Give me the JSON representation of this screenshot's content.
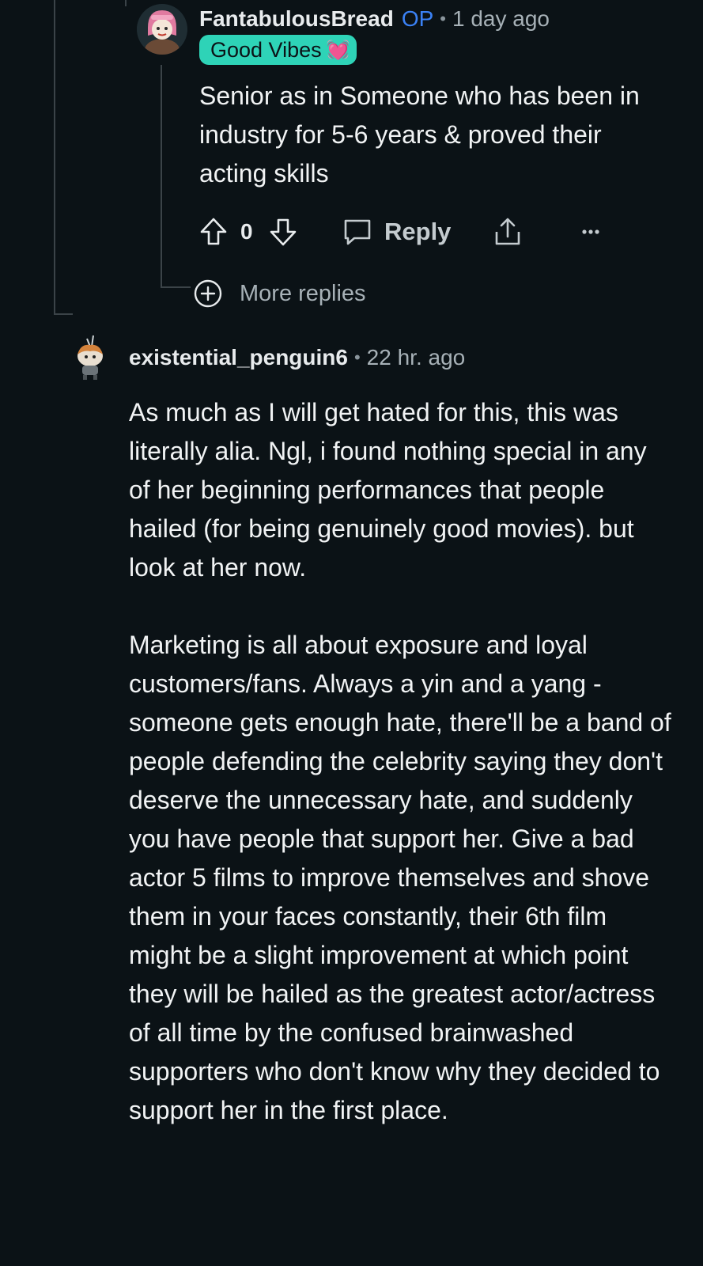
{
  "comment_reply": {
    "author": "FantabulousBread",
    "op_tag": "OP",
    "separator": "•",
    "time": "1 day ago",
    "flair": {
      "text": "Good Vibes",
      "emoji": "💓",
      "color": "#2ed3b7"
    },
    "body": [
      "Senior as in Someone who has been in industry for 5-6 years & proved their acting skills"
    ],
    "actions": {
      "upvote_icon": "arrow-up-icon",
      "score": "0",
      "downvote_icon": "arrow-down-icon",
      "reply_icon": "comment-bubble-icon",
      "reply_label": "Reply",
      "share_icon": "share-icon",
      "overflow_icon": "more-horizontal-icon"
    },
    "more_replies": {
      "icon": "plus-circle-icon",
      "label": "More replies"
    }
  },
  "comment_main": {
    "author": "existential_penguin6",
    "separator": "•",
    "time": "22 hr. ago",
    "body": [
      "As much as I will get hated for this, this was literally alia. Ngl, i found nothing special in any of her beginning performances that people hailed (for being genuinely good movies). but look at her now.",
      "Marketing is all about exposure and loyal customers/fans. Always a yin and a yang - someone gets enough hate, there'll be a band of people defending the celebrity saying they don't deserve the unnecessary hate, and suddenly you have people that support her. Give a bad actor 5 films to improve themselves and shove them in your faces constantly, their 6th film might be a slight improvement at which point they will be hailed as the greatest actor/actress of all time by the confused brainwashed supporters who don't know why they decided to support her in the first place."
    ]
  },
  "colors": {
    "background": "#0b1216",
    "thread_line": "#3b4348",
    "op_blue": "#3b82f6",
    "muted_text": "#a7b1b7"
  }
}
